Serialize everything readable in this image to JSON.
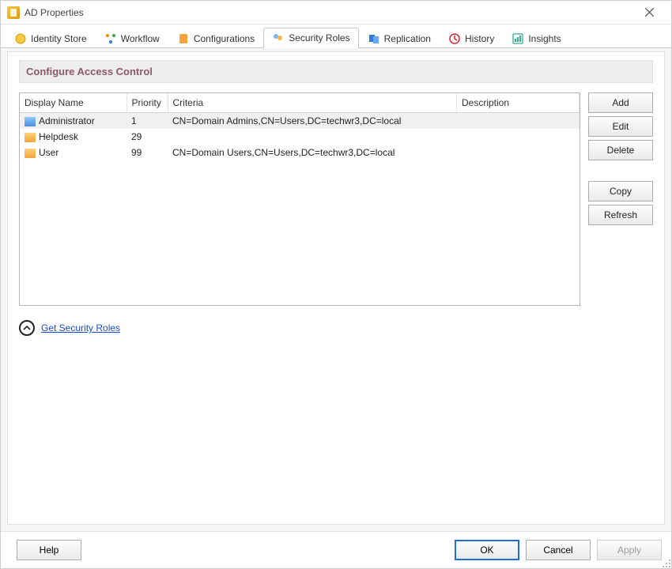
{
  "window": {
    "title": "AD Properties"
  },
  "tabs": [
    {
      "label": "Identity Store",
      "active": false
    },
    {
      "label": "Workflow",
      "active": false
    },
    {
      "label": "Configurations",
      "active": false
    },
    {
      "label": "Security Roles",
      "active": true
    },
    {
      "label": "Replication",
      "active": false
    },
    {
      "label": "History",
      "active": false
    },
    {
      "label": "Insights",
      "active": false
    }
  ],
  "section": {
    "title": "Configure Access Control"
  },
  "table": {
    "columns": [
      "Display Name",
      "Priority",
      "Criteria",
      "Description"
    ],
    "rows": [
      {
        "display_name": "Administrator",
        "priority": "1",
        "criteria": "CN=Domain Admins,CN=Users,DC=techwr3,DC=local",
        "description": "",
        "selected": true,
        "icon": "blue"
      },
      {
        "display_name": "Helpdesk",
        "priority": "29",
        "criteria": "",
        "description": "",
        "selected": false,
        "icon": "orange"
      },
      {
        "display_name": "User",
        "priority": "99",
        "criteria": "CN=Domain Users,CN=Users,DC=techwr3,DC=local",
        "description": "",
        "selected": false,
        "icon": "orange"
      }
    ]
  },
  "side_buttons": {
    "add": "Add",
    "edit": "Edit",
    "delete": "Delete",
    "copy": "Copy",
    "refresh": "Refresh"
  },
  "link": {
    "label": "Get Security Roles"
  },
  "footer": {
    "help": "Help",
    "ok": "OK",
    "cancel": "Cancel",
    "apply": "Apply"
  }
}
